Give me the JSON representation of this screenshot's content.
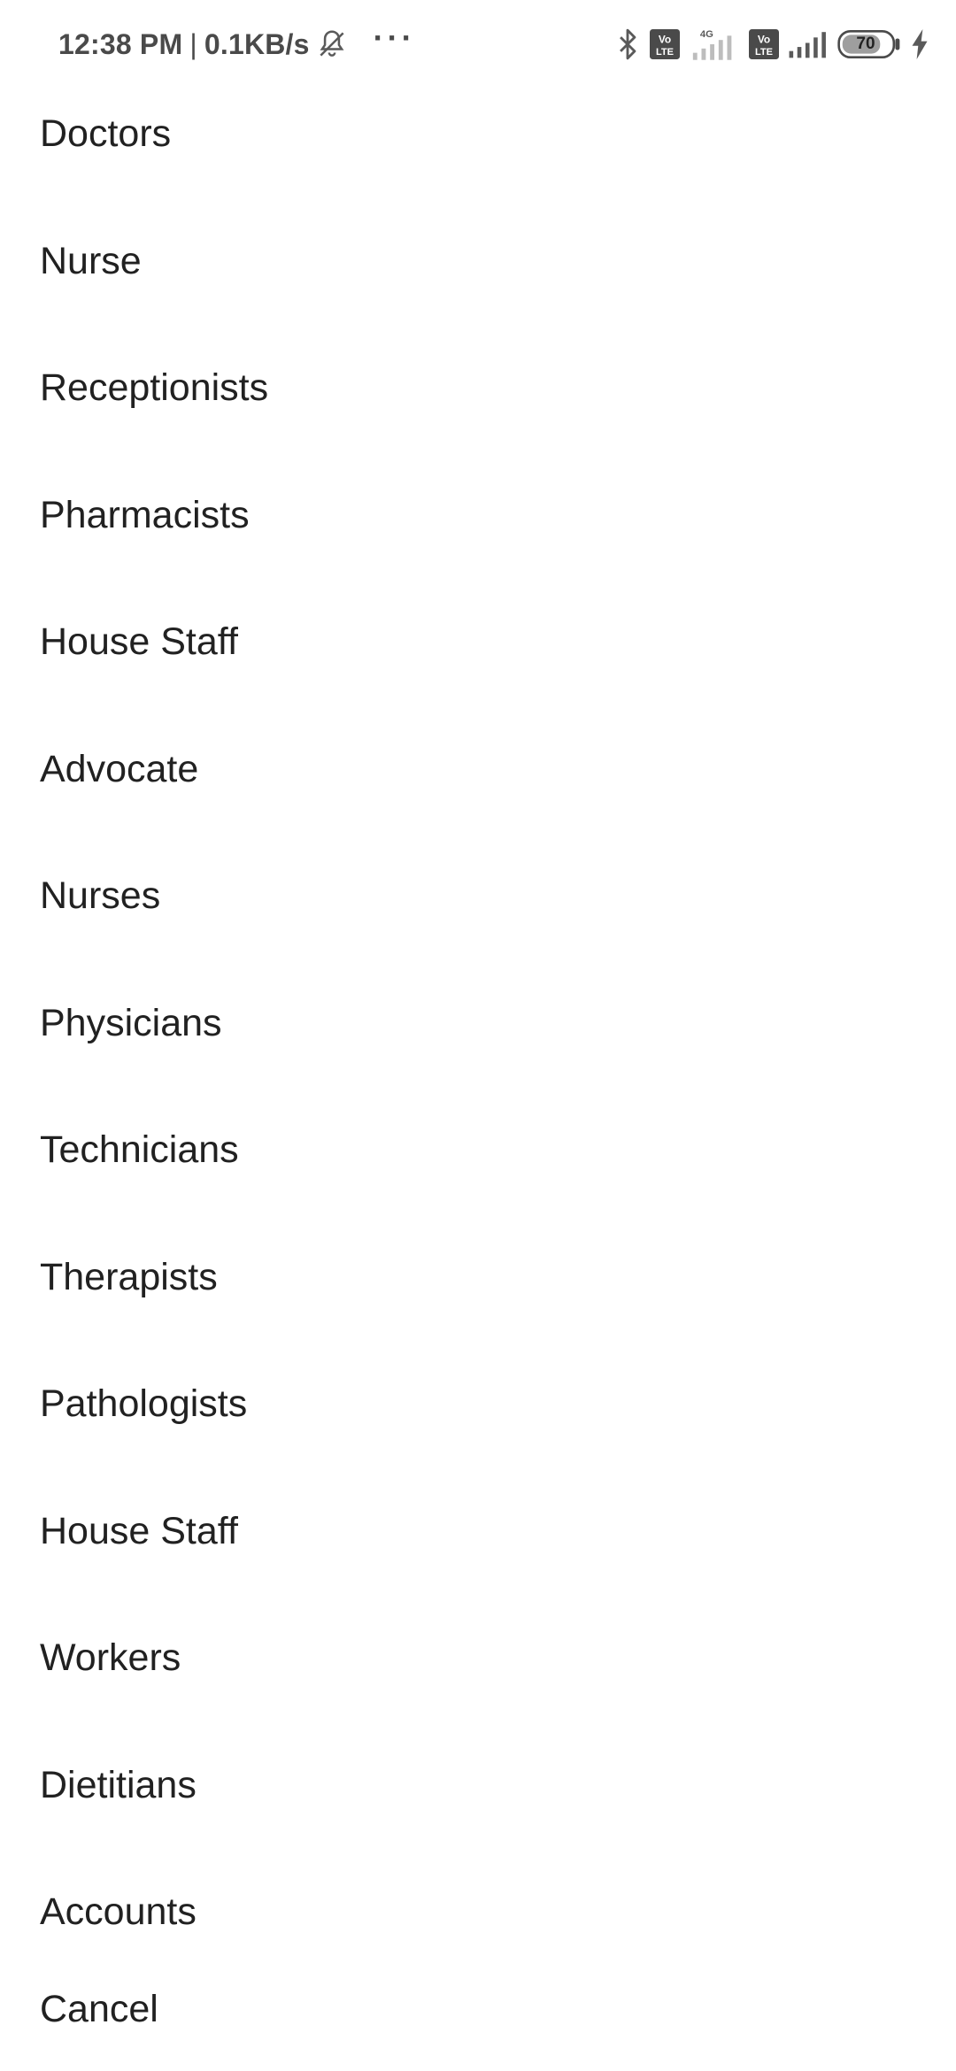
{
  "status_bar": {
    "time": "12:38 PM",
    "separator": "|",
    "net_speed": "0.1KB/s",
    "more": "···",
    "network_label": "4G",
    "volte_label": "Vo LTE",
    "battery_level": "70",
    "icons": [
      "mute-bell-icon",
      "bluetooth-icon",
      "volte-icon",
      "signal-icon",
      "battery-icon",
      "charging-icon"
    ]
  },
  "menu": {
    "items": [
      "Doctors",
      "Nurse",
      "Receptionists",
      "Pharmacists",
      "House Staff",
      "Advocate",
      "Nurses",
      "Physicians",
      "Technicians",
      "Therapists",
      "Pathologists",
      "House Staff",
      "Workers",
      "Dietitians",
      "Accounts"
    ],
    "cancel_label": "Cancel"
  }
}
